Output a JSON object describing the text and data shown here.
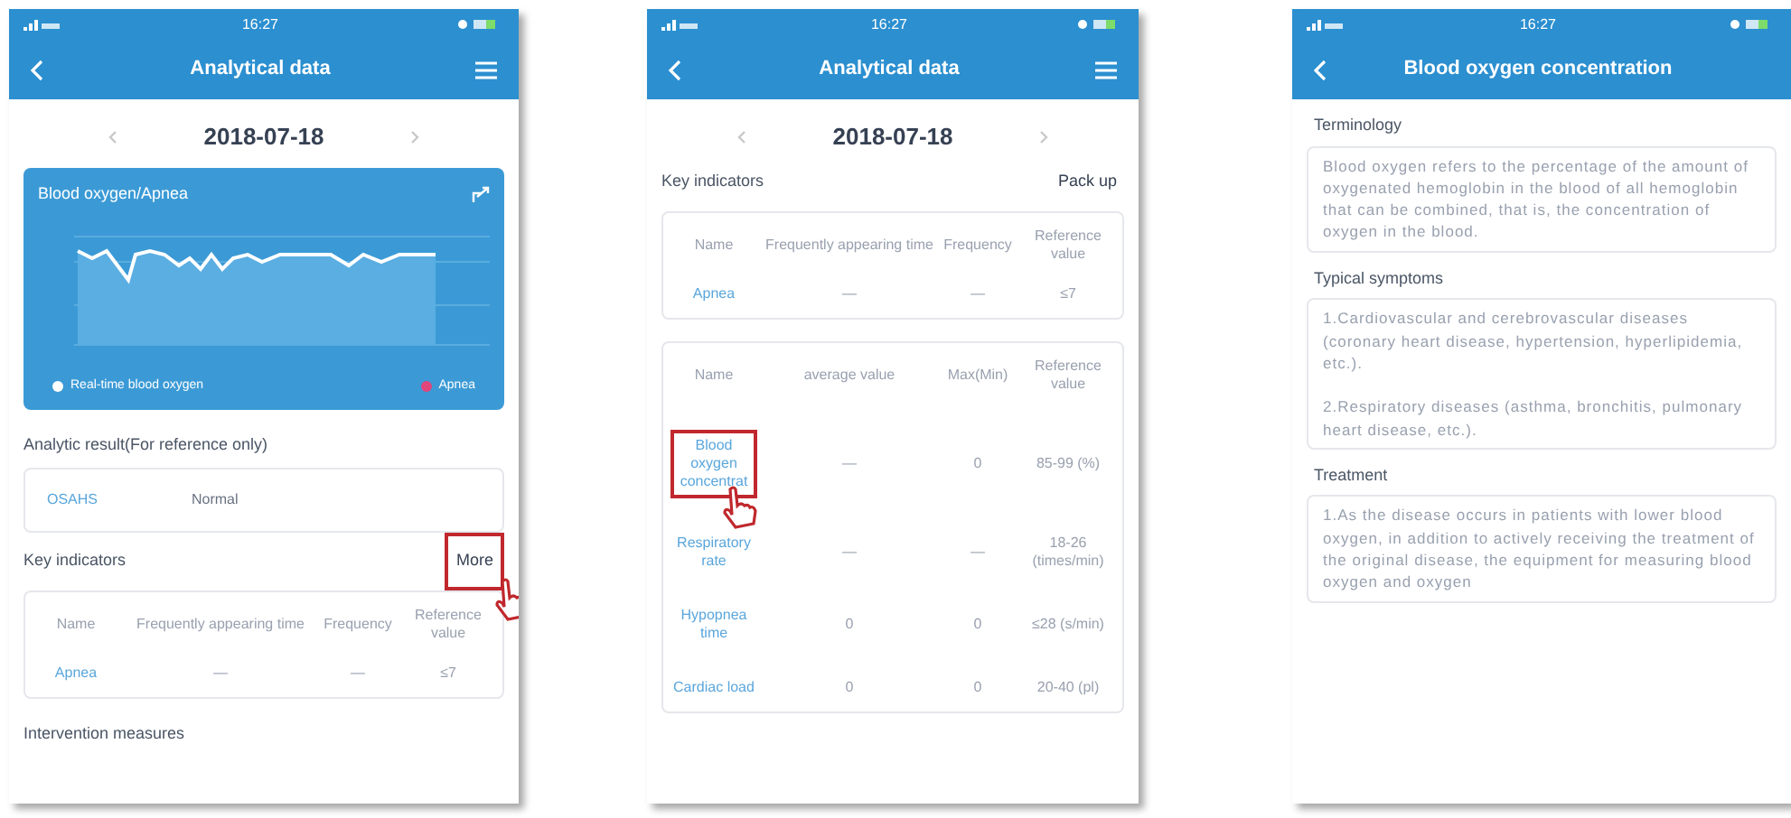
{
  "screens": [
    {
      "kind": "overview",
      "time": "16:27",
      "title": "Analytical data",
      "date": "2018-07-18",
      "chart": {
        "title": "Blood oxygen/Apnea",
        "legend": [
          {
            "label": "Real-time blood oxygen",
            "color": "#ffffff"
          },
          {
            "label": "Apnea",
            "color": "#e0457b"
          }
        ]
      },
      "result_heading": "Analytic result(For reference only)",
      "result": {
        "name": "OSAHS",
        "value": "Normal"
      },
      "indicators_heading": "Key indicators",
      "action": {
        "label": "More",
        "highlighted": true
      },
      "tables": [
        {
          "columns": [
            "Name",
            "Frequently appearing time",
            "Frequency",
            "Reference value"
          ],
          "rows": [
            {
              "cells": [
                "Apnea",
                "—",
                "—",
                "≤7"
              ],
              "highlighted": false
            }
          ]
        }
      ],
      "footer_heading": "Intervention measures"
    },
    {
      "kind": "indicators",
      "time": "16:27",
      "title": "Analytical data",
      "date": "2018-07-18",
      "indicators_heading": "Key indicators",
      "action": {
        "label": "Pack up",
        "highlighted": false
      },
      "tables": [
        {
          "columns": [
            "Name",
            "Frequently appearing time",
            "Frequency",
            "Reference value"
          ],
          "rows": [
            {
              "cells": [
                "Apnea",
                "—",
                "—",
                "≤7"
              ],
              "highlighted": false
            }
          ]
        },
        {
          "columns": [
            "Name",
            "average value",
            "Max(Min)",
            "Reference value"
          ],
          "rows": [
            {
              "cells": [
                "Blood oxygen concentrat",
                "—",
                "0",
                "85-99 (%)"
              ],
              "highlighted": true
            },
            {
              "cells": [
                "Respiratory rate",
                "—",
                "—",
                "18-26 (times/min)"
              ],
              "highlighted": false
            },
            {
              "cells": [
                "Hypopnea time",
                "0",
                "0",
                "≤28 (s/min)"
              ],
              "highlighted": false
            },
            {
              "cells": [
                "Cardiac load",
                "0",
                "0",
                "20-40 (pl)"
              ],
              "highlighted": false
            }
          ]
        }
      ]
    },
    {
      "kind": "detail",
      "time": "16:27",
      "title": "Blood oxygen concentration",
      "sections": [
        {
          "heading": "Terminology",
          "paragraphs": [
            "Blood oxygen refers to the percentage of the amount of oxygenated hemoglobin in the blood of all hemoglobin that can be combined, that is, the concentration of oxygen in the blood."
          ]
        },
        {
          "heading": "Typical symptoms",
          "paragraphs": [
            "1.Cardiovascular and cerebrovascular diseases (coronary heart disease, hypertension, hyperlipidemia, etc.).",
            "2.Respiratory diseases (asthma, bronchitis, pulmonary heart disease, etc.)."
          ]
        },
        {
          "heading": "Treatment",
          "paragraphs": [
            "1.As the disease occurs in patients with lower blood oxygen, in addition to actively receiving the treatment of the original disease, the equipment for measuring blood oxygen and oxygen"
          ]
        }
      ]
    }
  ]
}
